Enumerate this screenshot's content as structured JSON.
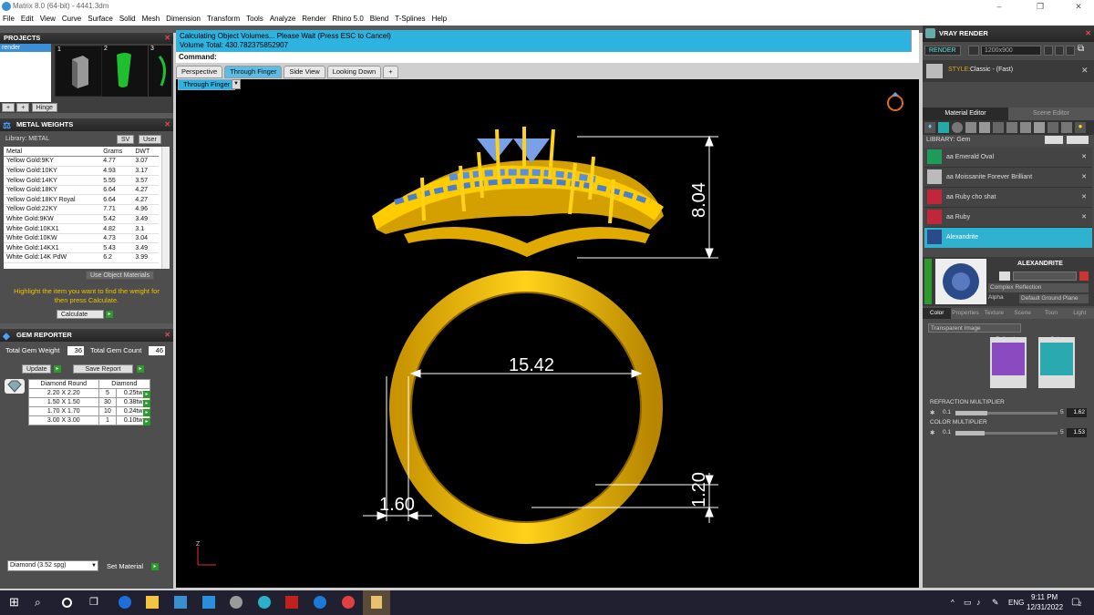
{
  "window": {
    "title": "Matrix 8.0 (64-bit) - 4441.3dm",
    "controls": [
      "–",
      "❐",
      "✕"
    ]
  },
  "menu": [
    "File",
    "Edit",
    "View",
    "Curve",
    "Surface",
    "Solid",
    "Mesh",
    "Dimension",
    "Transform",
    "Tools",
    "Analyze",
    "Render",
    "Rhino 5.0",
    "Blend",
    "T-Splines",
    "Help"
  ],
  "projects": {
    "title": "PROJECTS",
    "item": "render",
    "thumb_numbers": [
      "1",
      "2",
      "3"
    ],
    "hinge_label": "Hinge"
  },
  "metal_weights": {
    "title": "METAL WEIGHTS",
    "library_label": "Library:",
    "library_value": "METAL",
    "sv_label": "SV",
    "user_label": "User",
    "columns": [
      "Metal",
      "Grams",
      "DWT"
    ],
    "rows": [
      [
        "Yellow Gold:9KY",
        "4.77",
        "3.07"
      ],
      [
        "Yellow Gold:10KY",
        "4.93",
        "3.17"
      ],
      [
        "Yellow Gold:14KY",
        "5.55",
        "3.57"
      ],
      [
        "Yellow Gold:18KY",
        "6.64",
        "4.27"
      ],
      [
        "Yellow Gold:18KY Royal",
        "6.64",
        "4.27"
      ],
      [
        "Yellow Gold:22KY",
        "7.71",
        "4.96"
      ],
      [
        "White Gold:9KW",
        "5.42",
        "3.49"
      ],
      [
        "White Gold:10KX1",
        "4.82",
        "3.1"
      ],
      [
        "White Gold:10KW",
        "4.73",
        "3.04"
      ],
      [
        "White Gold:14KX1",
        "5.43",
        "3.49"
      ],
      [
        "White Gold:14K PdW",
        "6.2",
        "3.99"
      ]
    ],
    "use_object_materials": "Use Object Materials",
    "hint": "Highlight the item you want to find the weight for then press Calculate.",
    "calculate": "Calculate"
  },
  "gem_reporter": {
    "title": "GEM REPORTER",
    "total_weight_label": "Total Gem Weight",
    "total_weight_value": "36",
    "total_count_label": "Total Gem Count",
    "total_count_value": "46",
    "update": "Update",
    "save_report": "Save Report",
    "col1": "Diamond Round",
    "col2": "Diamond",
    "rows": [
      [
        "2.20 X 2.20",
        "5",
        "0.25tw"
      ],
      [
        "1.50 X 1.50",
        "30",
        "0.38tw"
      ],
      [
        "1.70 X 1.70",
        "10",
        "0.24tw"
      ],
      [
        "3.00 X 3.00",
        "1",
        "0.10tw"
      ]
    ],
    "material_select": "Diamond     (3.52 spg)",
    "set_material": "Set Material"
  },
  "console": {
    "line1": "Calculating Object Volumes... Please Wait (Press ESC to Cancel)",
    "line2": "Volume Total: 430.782375852907",
    "command_label": "Command:"
  },
  "view_tabs": [
    "Perspective",
    "Through Finger",
    "Side View",
    "Looking Down",
    "+"
  ],
  "active_tab": "Through Finger",
  "viewport": {
    "label": "Through Finger",
    "dimensions": {
      "top_height": "8.04",
      "inner_diameter": "15.42",
      "band_width": "1.60",
      "shank_thickness": "1.20"
    },
    "axis": "Z"
  },
  "vray": {
    "title": "VRAY RENDER",
    "render_btn": "RENDER",
    "resolution": "1200x900",
    "style_label": "STYLE:",
    "style_value": "Classic - (Fast)",
    "tabs": [
      "Material Editor",
      "Scene Editor"
    ],
    "library_label": "LIBRARY: Gem",
    "materials": [
      "aa Emerald Oval",
      "aa Moissanite Forever Brilliant",
      "aa Ruby cho shat",
      "aa Ruby",
      "Alexandrite"
    ],
    "selected_material": "Alexandrite",
    "material_name": "ALEXANDRITE",
    "reflection": "Complex Reflection",
    "alpha_label": "Alpha",
    "ground": "Default Ground Plane",
    "prop_tabs": [
      "Color",
      "Properties",
      "Texture",
      "Scene",
      "Toon",
      "Light"
    ],
    "transparent": "Transparent Image",
    "swatch_refraction": "Refraction",
    "swatch_color": "Color",
    "refraction_multiplier": {
      "label": "REFRACTION MULTIPLIER",
      "min": "0.1",
      "max": "5",
      "value": "1.62",
      "fraction": 0.31
    },
    "color_multiplier": {
      "label": "COLOR MULTIPLIER",
      "min": "0.1",
      "max": "5",
      "value": "1.53",
      "fraction": 0.29
    },
    "colors": {
      "emerald": "#1f9a5a",
      "ruby": "#c2263a",
      "alexandrite": "#2a4a8a"
    }
  },
  "taskbar": {
    "lang": "ENG",
    "time": "9:11 PM",
    "date": "12/31/2022",
    "notify_count": "2"
  }
}
